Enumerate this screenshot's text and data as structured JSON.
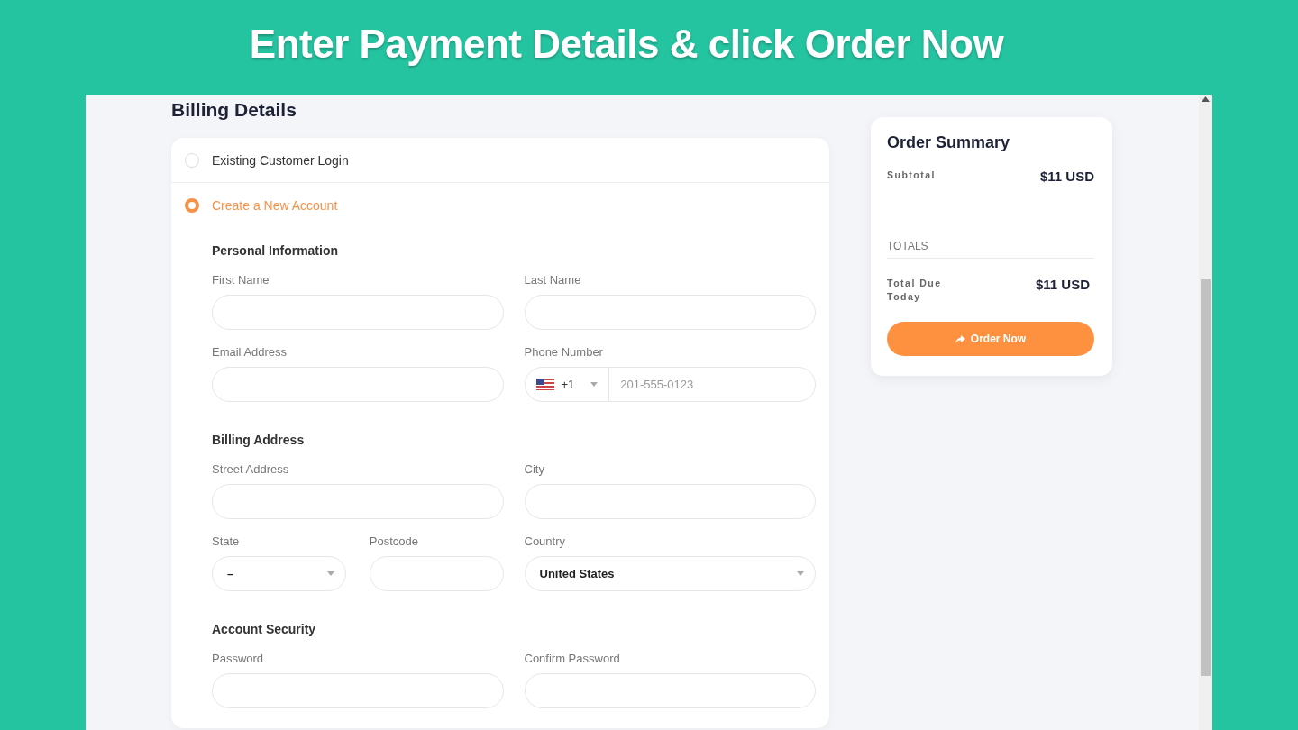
{
  "banner": {
    "title": "Enter Payment Details & click Order Now"
  },
  "billing": {
    "title": "Billing Details",
    "options": [
      {
        "label": "Existing Customer Login",
        "selected": false
      },
      {
        "label": "Create a New Account",
        "selected": true
      }
    ],
    "sections": [
      {
        "title": "Personal Information",
        "rows": [
          [
            {
              "label": "First Name",
              "kind": "text"
            },
            {
              "label": "Last Name",
              "kind": "text"
            }
          ],
          [
            {
              "label": "Email Address",
              "kind": "text"
            },
            {
              "label": "Phone Number",
              "kind": "phone",
              "code": "+1",
              "placeholder": "201-555-0123"
            }
          ]
        ]
      },
      {
        "title": "Billing Address",
        "rows": [
          [
            {
              "label": "Street Address",
              "kind": "text"
            },
            {
              "label": "City",
              "kind": "text"
            }
          ],
          [
            {
              "kind": "pair",
              "fields": [
                {
                  "label": "State",
                  "kind": "select",
                  "value": "–"
                },
                {
                  "label": "Postcode",
                  "kind": "text"
                }
              ]
            },
            {
              "label": "Country",
              "kind": "select",
              "value": "United States"
            }
          ]
        ]
      },
      {
        "title": "Account Security",
        "rows": [
          [
            {
              "label": "Password",
              "kind": "text"
            },
            {
              "label": "Confirm Password",
              "kind": "text"
            }
          ]
        ]
      }
    ]
  },
  "summary": {
    "title": "Order Summary",
    "subtotal": {
      "label": "Subtotal",
      "value": "$11 USD"
    },
    "totals_heading": "TOTALS",
    "total": {
      "label": "Total Due Today",
      "value": "$11 USD"
    },
    "button": "Order Now"
  }
}
